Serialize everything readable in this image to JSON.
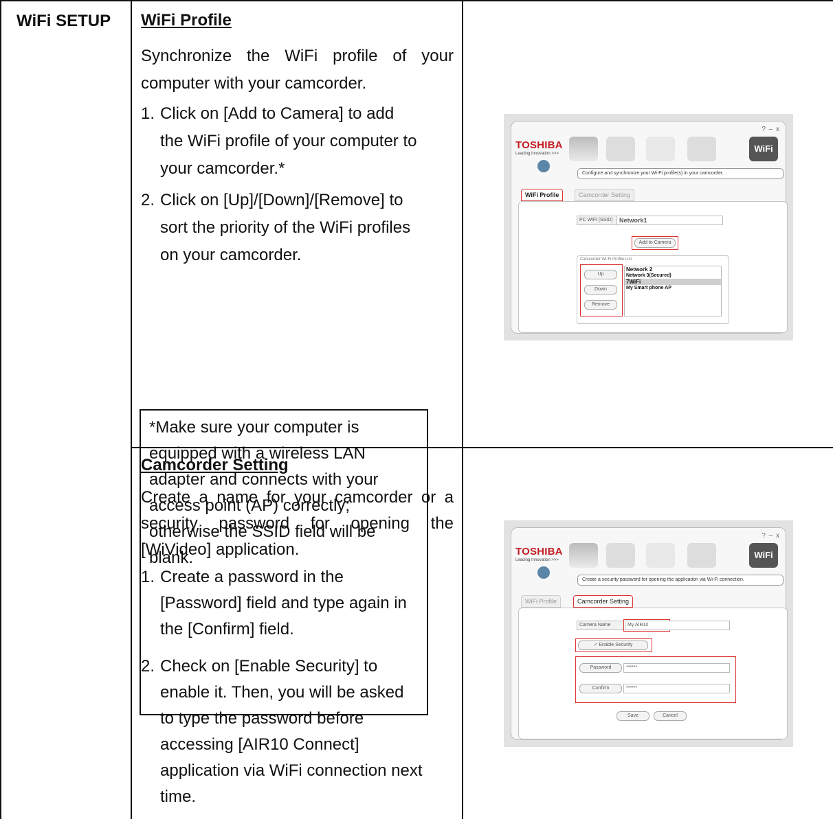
{
  "table": {
    "category": "WiFi SETUP",
    "rows": [
      {
        "title": "WiFi Profile",
        "intro": "Synchronize the WiFi profile of your computer with your camcorder.",
        "steps": [
          {
            "num": "1.",
            "lines": [
              "Click on [Add to Camera] to add",
              "the WiFi profile of your computer to",
              "your camcorder.*"
            ]
          },
          {
            "num": "2.",
            "lines": [
              "Click on [Up]/[Down]/[Remove] to",
              "sort the priority of the WiFi profiles",
              "on your camcorder."
            ]
          }
        ],
        "note_lines": [
          "*Make sure your computer is",
          "equipped with a wireless LAN",
          "adapter and connects with your",
          "access point (AP) correctly;",
          "otherwise the SSID field will be",
          "blank."
        ]
      },
      {
        "title": "Camcorder Setting",
        "intro": "Create a name for your camcorder or a security password for opening the [WiVideo] application.",
        "steps": [
          {
            "num": "1.",
            "lines": [
              "Create a password in the",
              "[Password] field and type again in",
              "the [Confirm] field."
            ]
          },
          {
            "num": "2.",
            "lines": [
              "Check on [Enable Security] to",
              "enable it. Then, you will be asked",
              "to type the password before",
              "accessing [AIR10 Connect]",
              "application via WiFi connection next",
              "time."
            ]
          }
        ]
      }
    ]
  },
  "screenshots": {
    "common": {
      "brand": "TOSHIBA",
      "tagline": "Leading Innovation >>>",
      "window_controls": "?  –  x",
      "wifi_badge": "WiFi",
      "tab_wifi_profile": "WiFi Profile",
      "tab_camcorder_setting": "Camcorder Setting"
    },
    "wifi_profile": {
      "description": "Configure and synchronize your Wi-Fi profile(s) in your camcorder.",
      "pc_ssid_label": "PC WiFi (SSID)",
      "pc_ssid_value": "Network1",
      "add_button": "Add to Camera",
      "list_label": "Camcorder Wi-Fi Profile List",
      "list_buttons": [
        "Up",
        "Down",
        "Remove"
      ],
      "profiles": [
        "Network 2",
        "Network 3(Secured)",
        "7WiFi",
        "My Smart phone AP"
      ],
      "selected_index": 2
    },
    "camcorder_setting": {
      "description": "Create a security password for opening the application via Wi-Fi connection.",
      "camera_name_label": "Camera Name",
      "camera_name_value": "My AIR10",
      "enable_security_label": "Enable Security",
      "enable_security_checked": true,
      "password_label": "Password",
      "password_value": "******",
      "confirm_label": "Confirm",
      "confirm_value": "******",
      "save_button": "Save",
      "cancel_button": "Cancel"
    }
  }
}
